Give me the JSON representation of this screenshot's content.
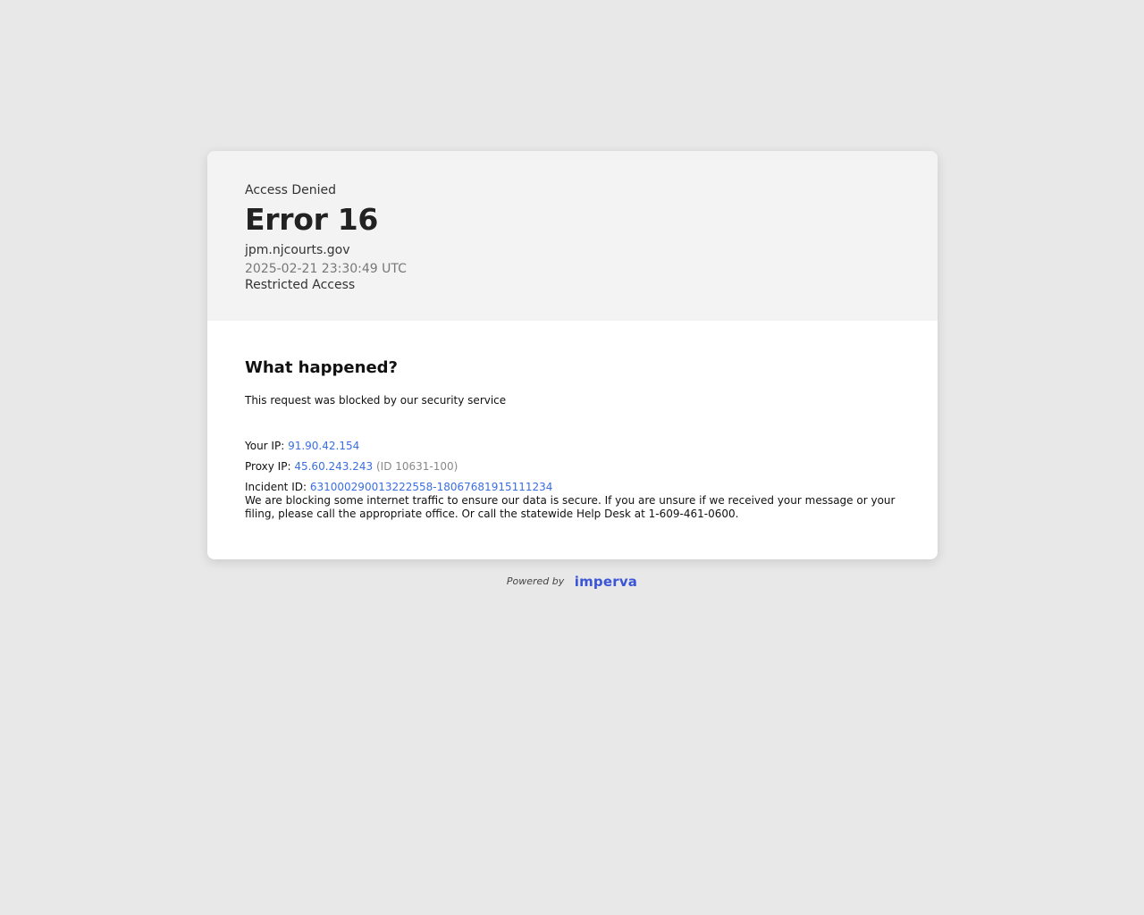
{
  "header": {
    "access_denied": "Access Denied",
    "error_title": "Error 16",
    "domain": "jpm.njcourts.gov",
    "timestamp": "2025-02-21 23:30:49 UTC",
    "restricted": "Restricted Access"
  },
  "body": {
    "heading": "What happened?",
    "blocked_text": "This request was blocked by our security service",
    "your_ip_label": "Your IP:",
    "your_ip_value": "91.90.42.154",
    "proxy_ip_label": "Proxy IP:",
    "proxy_ip_value": "45.60.243.243",
    "proxy_ip_id": "(ID 10631-100)",
    "incident_label": "Incident ID:",
    "incident_value": "631000290013222558-18067681915111234",
    "message": "We are blocking some internet traffic to ensure our data is secure. If you are unsure if we received your message or your filing, please call the appropriate office. Or call the statewide Help Desk at 1-609-461-0600."
  },
  "footer": {
    "powered_by": "Powered by",
    "brand": "imperva"
  },
  "colors": {
    "background": "#e8e8e8",
    "header_bg": "#f3f3f3",
    "link": "#3b6ee0",
    "brand": "#3a55d6"
  }
}
